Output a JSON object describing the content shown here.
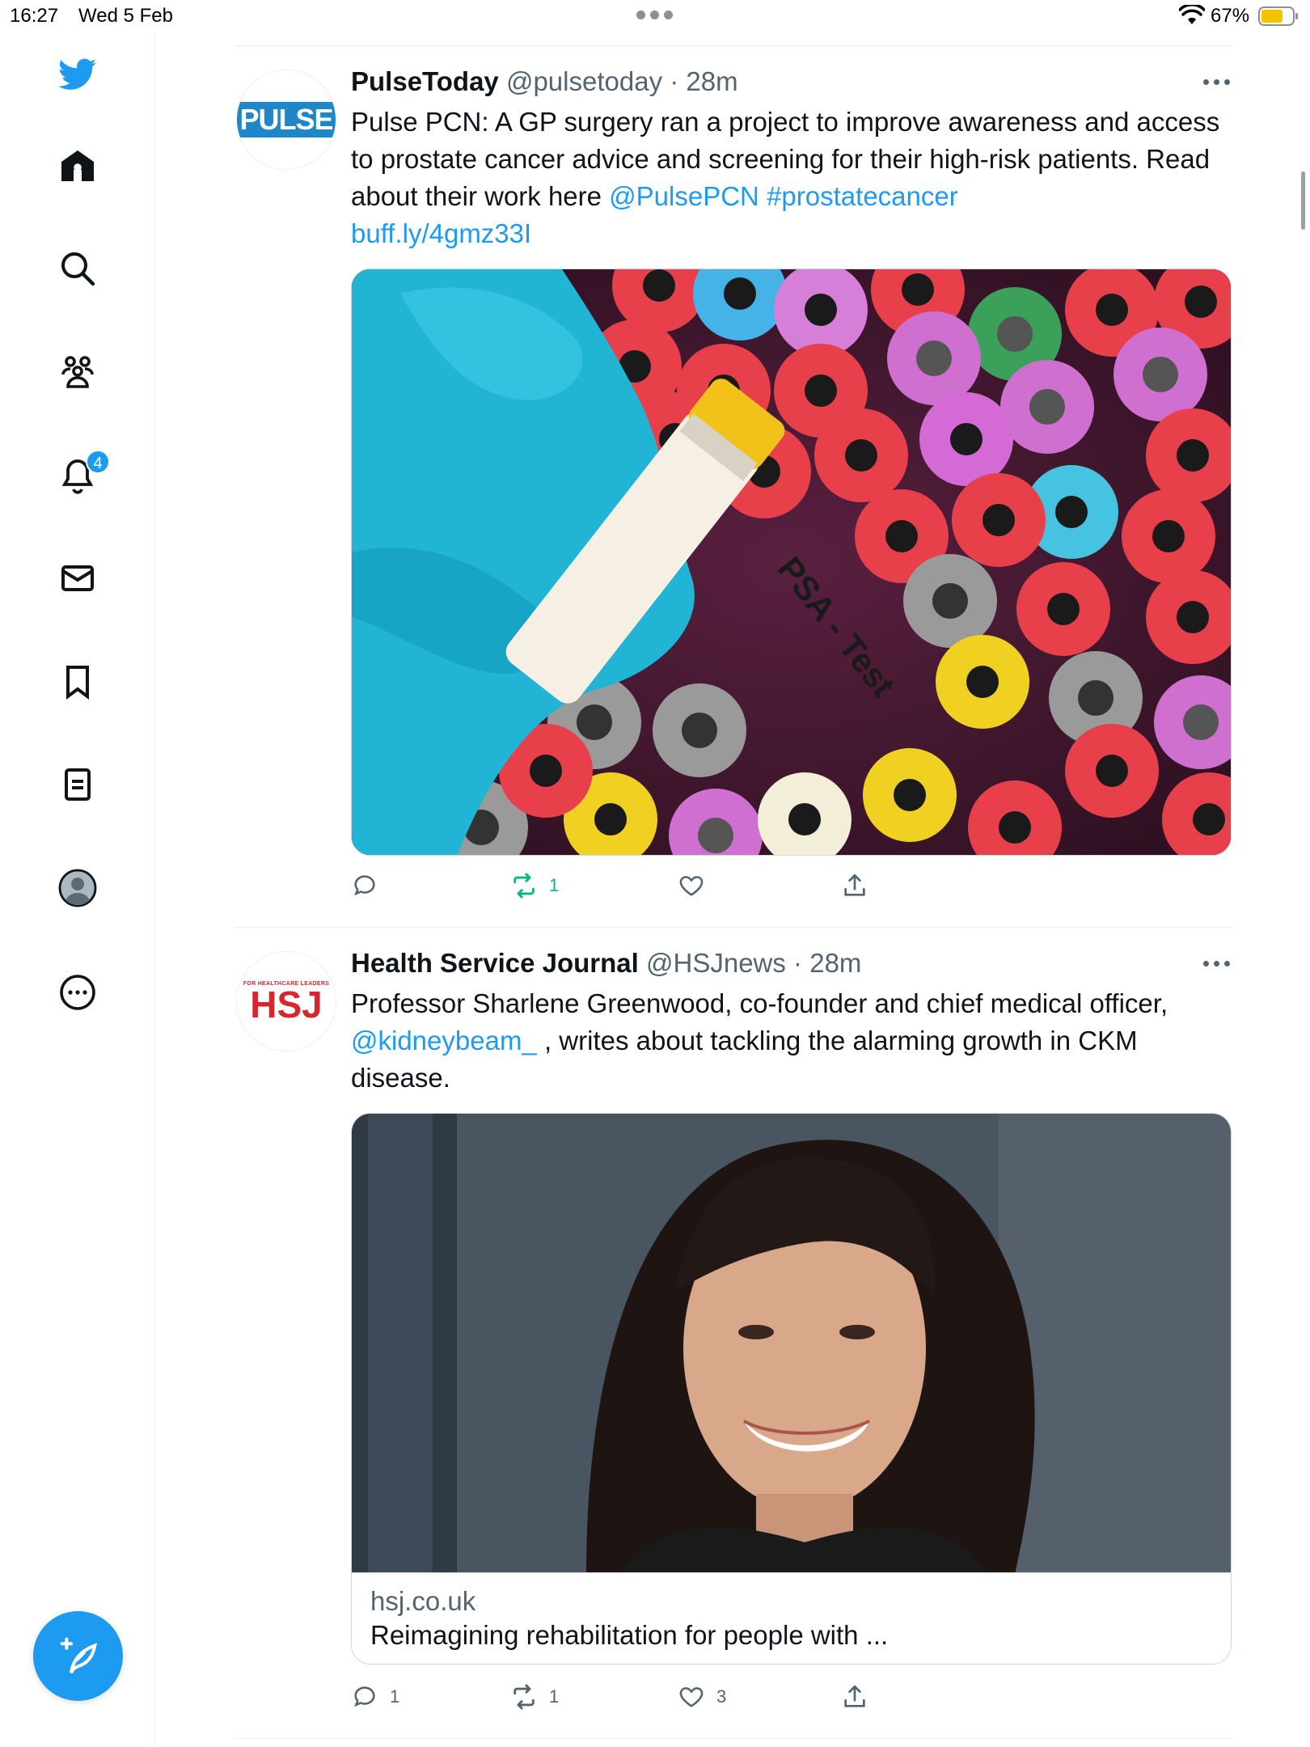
{
  "status_bar": {
    "time": "16:27",
    "date": "Wed 5 Feb",
    "battery": "67%"
  },
  "sidebar": {
    "items": [
      {
        "icon": "twitter-bird-icon"
      },
      {
        "icon": "home-icon"
      },
      {
        "icon": "search-icon"
      },
      {
        "icon": "communities-icon"
      },
      {
        "icon": "notifications-icon",
        "badge": "4"
      },
      {
        "icon": "messages-icon"
      },
      {
        "icon": "bookmarks-icon"
      },
      {
        "icon": "lists-icon"
      },
      {
        "icon": "profile-icon"
      },
      {
        "icon": "more-icon"
      }
    ],
    "compose_icon": "compose-feather-icon"
  },
  "colors": {
    "accent": "#1d9bf0",
    "retweet_active": "#00ba7c",
    "text": "#0f1419",
    "muted": "#536471"
  },
  "tweets": [
    {
      "name": "PulseToday",
      "handle": "@pulsetoday",
      "sep": " · ",
      "time": "28m",
      "avatar_logo": "PULSE",
      "text": "Pulse PCN: A GP surgery ran a project to improve awareness and access to prostate cancer advice and screening for their high-risk patients. Read about their work here ",
      "links": [
        "@PulsePCN",
        "#prostatecancer",
        "buff.ly/4gmz33I"
      ],
      "media_label": "PSA - Test",
      "actions": {
        "reply": "",
        "retweet": "1",
        "like": "",
        "share": ""
      }
    },
    {
      "name": "Health Service Journal",
      "handle": "@HSJnews",
      "sep": " · ",
      "time": "28m",
      "avatar_logo": "HSJ",
      "avatar_tagline": "FOR HEALTHCARE LEADERS",
      "text_before": "Professor Sharlene Greenwood, co-founder and chief medical officer, ",
      "mention": "@kidneybeam_",
      "text_after": " , writes about tackling the alarming growth in CKM disease.",
      "card": {
        "domain": "hsj.co.uk",
        "title": "Reimagining rehabilitation for people with ..."
      },
      "actions": {
        "reply": "1",
        "retweet": "1",
        "like": "3",
        "share": ""
      }
    }
  ]
}
